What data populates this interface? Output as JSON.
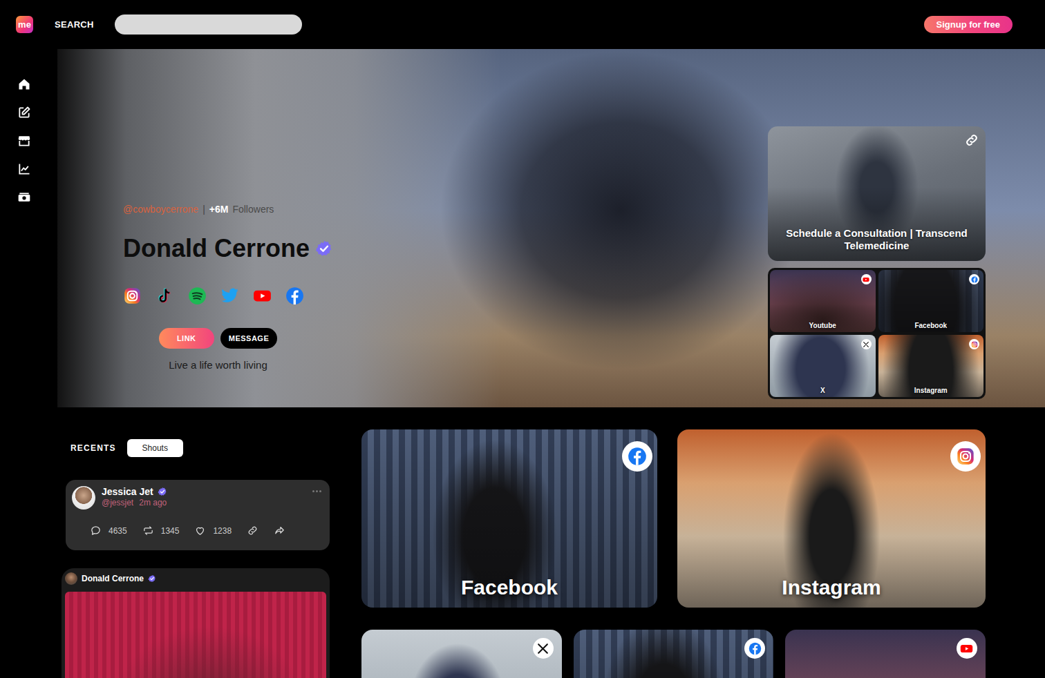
{
  "header": {
    "logo": "me",
    "search_label": "SEARCH",
    "signup": "Signup for free"
  },
  "profile": {
    "handle": "@cowboycerrone",
    "separator": "|",
    "followers_count": "+6M",
    "followers_label": "Followers",
    "name": "Donald Cerrone",
    "verified": true,
    "socials": [
      {
        "kind": "instagram"
      },
      {
        "kind": "tiktok"
      },
      {
        "kind": "spotify"
      },
      {
        "kind": "twitter"
      },
      {
        "kind": "youtube"
      },
      {
        "kind": "facebook"
      }
    ],
    "buttons": [
      {
        "label": "LINK",
        "kind": "primary"
      },
      {
        "label": "MESSAGE",
        "kind": "secondary"
      }
    ],
    "bio": "Live a life worth living"
  },
  "featured": {
    "title": "Schedule a Consultation | Transcend Telemedicine"
  },
  "tiles": [
    {
      "label": "Youtube",
      "kind": "youtube"
    },
    {
      "label": "Facebook",
      "kind": "facebook"
    },
    {
      "label": "X",
      "kind": "x"
    },
    {
      "label": "Instagram",
      "kind": "instagram"
    }
  ],
  "recents": {
    "label": "RECENTS",
    "tabs": [
      {
        "label": "Shouts",
        "selected": true
      }
    ]
  },
  "posts": [
    {
      "author": "Jessica Jet",
      "verified": true,
      "handle": "@jessjet",
      "time": "2m ago",
      "comments": "4635",
      "reposts": "1345",
      "likes": "1238"
    },
    {
      "author": "Donald Cerrone",
      "verified": true
    }
  ],
  "cards": [
    {
      "label": "Facebook",
      "kind": "facebook"
    },
    {
      "label": "Instagram",
      "kind": "instagram"
    },
    {
      "kind": "x"
    },
    {
      "kind": "facebook"
    },
    {
      "kind": "youtube"
    }
  ]
}
